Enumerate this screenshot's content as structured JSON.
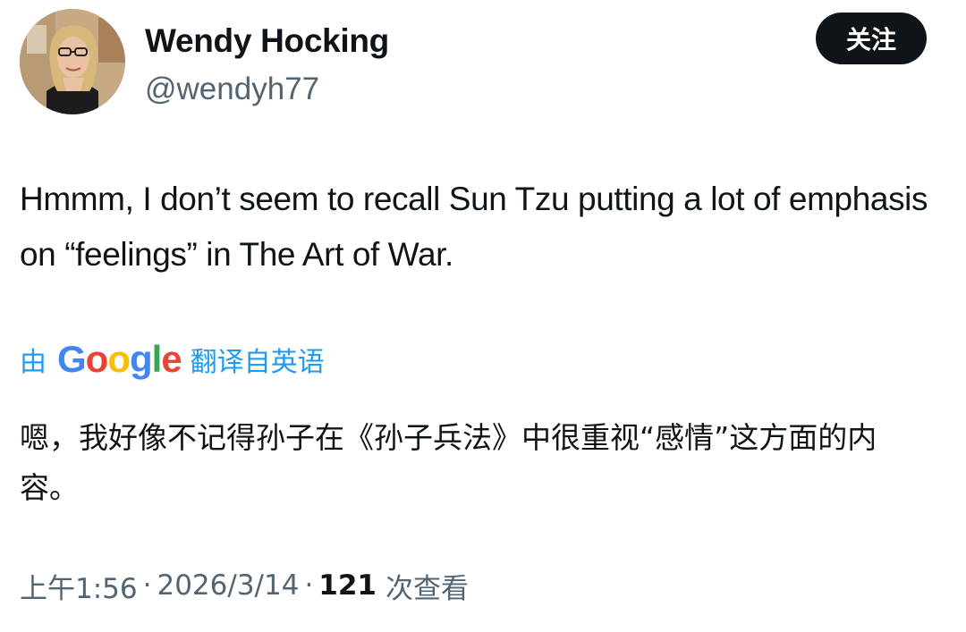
{
  "author": {
    "display_name": "Wendy Hocking",
    "handle": "@wendyh77"
  },
  "follow_button": {
    "label": "关注"
  },
  "tweet": {
    "text": "Hmmm, I don’t seem to recall Sun Tzu putting a lot of emphasis on “feelings” in The Art of War."
  },
  "translation": {
    "prefix": "由",
    "provider": "Google",
    "suffix": "翻译自英语",
    "text": "嗯，我好像不记得孙子在《孙子兵法》中很重视“感情”这方面的内容。"
  },
  "meta": {
    "time": "上午1:56",
    "separator": "·",
    "date": "2026/3/14",
    "views_count": "121",
    "views_label": "次查看"
  },
  "colors": {
    "link_blue": "#1d9bf0",
    "text_primary": "#0f1419",
    "text_secondary": "#536471",
    "button_bg": "#0f1419"
  },
  "icons": {
    "avatar": "profile-photo",
    "google_logo": "google-wordmark"
  }
}
